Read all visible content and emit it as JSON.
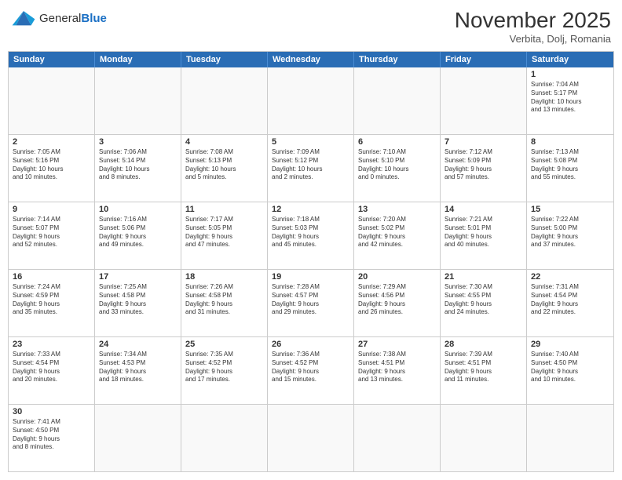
{
  "logo": {
    "text_general": "General",
    "text_blue": "Blue"
  },
  "title": "November 2025",
  "location": "Verbita, Dolj, Romania",
  "days_header": [
    "Sunday",
    "Monday",
    "Tuesday",
    "Wednesday",
    "Thursday",
    "Friday",
    "Saturday"
  ],
  "weeks": [
    [
      {
        "day": "",
        "info": ""
      },
      {
        "day": "",
        "info": ""
      },
      {
        "day": "",
        "info": ""
      },
      {
        "day": "",
        "info": ""
      },
      {
        "day": "",
        "info": ""
      },
      {
        "day": "",
        "info": ""
      },
      {
        "day": "1",
        "info": "Sunrise: 7:04 AM\nSunset: 5:17 PM\nDaylight: 10 hours\nand 13 minutes."
      }
    ],
    [
      {
        "day": "2",
        "info": "Sunrise: 7:05 AM\nSunset: 5:16 PM\nDaylight: 10 hours\nand 10 minutes."
      },
      {
        "day": "3",
        "info": "Sunrise: 7:06 AM\nSunset: 5:14 PM\nDaylight: 10 hours\nand 8 minutes."
      },
      {
        "day": "4",
        "info": "Sunrise: 7:08 AM\nSunset: 5:13 PM\nDaylight: 10 hours\nand 5 minutes."
      },
      {
        "day": "5",
        "info": "Sunrise: 7:09 AM\nSunset: 5:12 PM\nDaylight: 10 hours\nand 2 minutes."
      },
      {
        "day": "6",
        "info": "Sunrise: 7:10 AM\nSunset: 5:10 PM\nDaylight: 10 hours\nand 0 minutes."
      },
      {
        "day": "7",
        "info": "Sunrise: 7:12 AM\nSunset: 5:09 PM\nDaylight: 9 hours\nand 57 minutes."
      },
      {
        "day": "8",
        "info": "Sunrise: 7:13 AM\nSunset: 5:08 PM\nDaylight: 9 hours\nand 55 minutes."
      }
    ],
    [
      {
        "day": "9",
        "info": "Sunrise: 7:14 AM\nSunset: 5:07 PM\nDaylight: 9 hours\nand 52 minutes."
      },
      {
        "day": "10",
        "info": "Sunrise: 7:16 AM\nSunset: 5:06 PM\nDaylight: 9 hours\nand 49 minutes."
      },
      {
        "day": "11",
        "info": "Sunrise: 7:17 AM\nSunset: 5:05 PM\nDaylight: 9 hours\nand 47 minutes."
      },
      {
        "day": "12",
        "info": "Sunrise: 7:18 AM\nSunset: 5:03 PM\nDaylight: 9 hours\nand 45 minutes."
      },
      {
        "day": "13",
        "info": "Sunrise: 7:20 AM\nSunset: 5:02 PM\nDaylight: 9 hours\nand 42 minutes."
      },
      {
        "day": "14",
        "info": "Sunrise: 7:21 AM\nSunset: 5:01 PM\nDaylight: 9 hours\nand 40 minutes."
      },
      {
        "day": "15",
        "info": "Sunrise: 7:22 AM\nSunset: 5:00 PM\nDaylight: 9 hours\nand 37 minutes."
      }
    ],
    [
      {
        "day": "16",
        "info": "Sunrise: 7:24 AM\nSunset: 4:59 PM\nDaylight: 9 hours\nand 35 minutes."
      },
      {
        "day": "17",
        "info": "Sunrise: 7:25 AM\nSunset: 4:58 PM\nDaylight: 9 hours\nand 33 minutes."
      },
      {
        "day": "18",
        "info": "Sunrise: 7:26 AM\nSunset: 4:58 PM\nDaylight: 9 hours\nand 31 minutes."
      },
      {
        "day": "19",
        "info": "Sunrise: 7:28 AM\nSunset: 4:57 PM\nDaylight: 9 hours\nand 29 minutes."
      },
      {
        "day": "20",
        "info": "Sunrise: 7:29 AM\nSunset: 4:56 PM\nDaylight: 9 hours\nand 26 minutes."
      },
      {
        "day": "21",
        "info": "Sunrise: 7:30 AM\nSunset: 4:55 PM\nDaylight: 9 hours\nand 24 minutes."
      },
      {
        "day": "22",
        "info": "Sunrise: 7:31 AM\nSunset: 4:54 PM\nDaylight: 9 hours\nand 22 minutes."
      }
    ],
    [
      {
        "day": "23",
        "info": "Sunrise: 7:33 AM\nSunset: 4:54 PM\nDaylight: 9 hours\nand 20 minutes."
      },
      {
        "day": "24",
        "info": "Sunrise: 7:34 AM\nSunset: 4:53 PM\nDaylight: 9 hours\nand 18 minutes."
      },
      {
        "day": "25",
        "info": "Sunrise: 7:35 AM\nSunset: 4:52 PM\nDaylight: 9 hours\nand 17 minutes."
      },
      {
        "day": "26",
        "info": "Sunrise: 7:36 AM\nSunset: 4:52 PM\nDaylight: 9 hours\nand 15 minutes."
      },
      {
        "day": "27",
        "info": "Sunrise: 7:38 AM\nSunset: 4:51 PM\nDaylight: 9 hours\nand 13 minutes."
      },
      {
        "day": "28",
        "info": "Sunrise: 7:39 AM\nSunset: 4:51 PM\nDaylight: 9 hours\nand 11 minutes."
      },
      {
        "day": "29",
        "info": "Sunrise: 7:40 AM\nSunset: 4:50 PM\nDaylight: 9 hours\nand 10 minutes."
      }
    ],
    [
      {
        "day": "30",
        "info": "Sunrise: 7:41 AM\nSunset: 4:50 PM\nDaylight: 9 hours\nand 8 minutes."
      },
      {
        "day": "",
        "info": ""
      },
      {
        "day": "",
        "info": ""
      },
      {
        "day": "",
        "info": ""
      },
      {
        "day": "",
        "info": ""
      },
      {
        "day": "",
        "info": ""
      },
      {
        "day": "",
        "info": ""
      }
    ]
  ]
}
